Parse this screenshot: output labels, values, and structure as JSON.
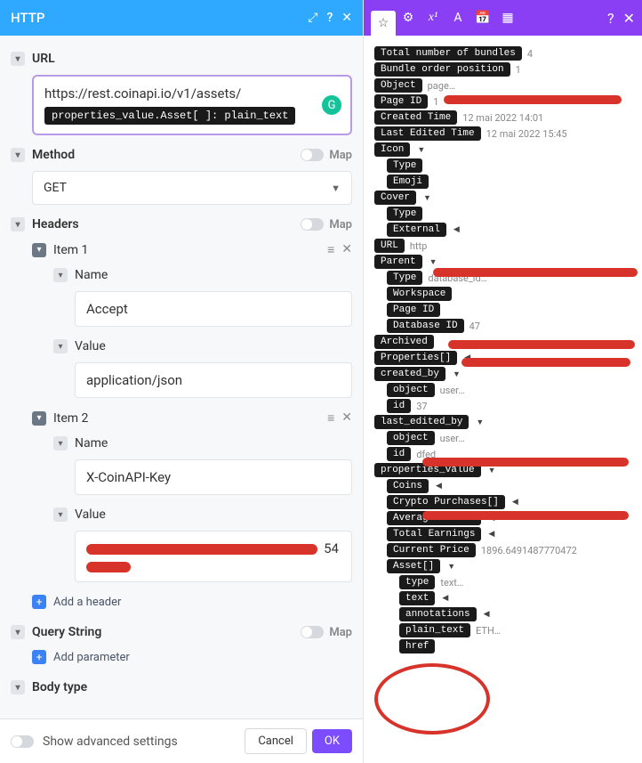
{
  "left": {
    "title": "HTTP",
    "url_label": "URL",
    "url_value": "https://rest.coinapi.io/v1/assets/",
    "url_pill": "properties_value.Asset[  ]: plain_text",
    "method_label": "Method",
    "method_value": "GET",
    "map": "Map",
    "headers_label": "Headers",
    "item1": "Item 1",
    "item2": "Item 2",
    "name_label": "Name",
    "value_label": "Value",
    "name1": "Accept",
    "value1": "application/json",
    "name2": "X-CoinAPI-Key",
    "value2_partial": "54",
    "add_header": "Add a header",
    "query_label": "Query String",
    "add_param": "Add parameter",
    "body_label": "Body type",
    "advanced": "Show advanced settings",
    "cancel": "Cancel",
    "ok": "OK"
  },
  "tree": {
    "total_bundles": {
      "k": "Total number of bundles",
      "v": "4"
    },
    "bundle_order": {
      "k": "Bundle order position",
      "v": "1"
    },
    "object": {
      "k": "Object",
      "v": "page…"
    },
    "page_id": {
      "k": "Page ID",
      "v": "1"
    },
    "created_time": {
      "k": "Created Time",
      "v": "12 mai 2022 14:01"
    },
    "last_edited": {
      "k": "Last Edited Time",
      "v": "12 mai 2022 15:45"
    },
    "icon": "Icon",
    "type": "Type",
    "emoji": "Emoji",
    "cover": "Cover",
    "external": "External",
    "url": {
      "k": "URL",
      "v": "http"
    },
    "parent": "Parent",
    "parent_type": {
      "k": "Type",
      "v": "database_id…"
    },
    "workspace": "Workspace",
    "page_id2": "Page ID",
    "database_id": {
      "k": "Database ID",
      "v": "47"
    },
    "archived": "Archived",
    "properties": "Properties[]",
    "created_by": "created_by",
    "cb_object": {
      "k": "object",
      "v": "user…"
    },
    "cb_id": {
      "k": "id",
      "v": "37"
    },
    "last_edited_by": "last_edited_by",
    "leb_object": {
      "k": "object",
      "v": "user…"
    },
    "leb_id": {
      "k": "id",
      "v": "dfed"
    },
    "prop_value": "properties_value",
    "coins": "Coins",
    "crypto": "Crypto Purchases[]",
    "avg": "Average Growth",
    "total_earn": "Total Earnings",
    "current_price": {
      "k": "Current Price",
      "v": "1896.6491487770472"
    },
    "asset": "Asset[]",
    "asset_type": {
      "k": "type",
      "v": "text…"
    },
    "text": "text",
    "annotations": "annotations",
    "plain_text": {
      "k": "plain_text",
      "v": "ETH…"
    },
    "href": "href"
  }
}
